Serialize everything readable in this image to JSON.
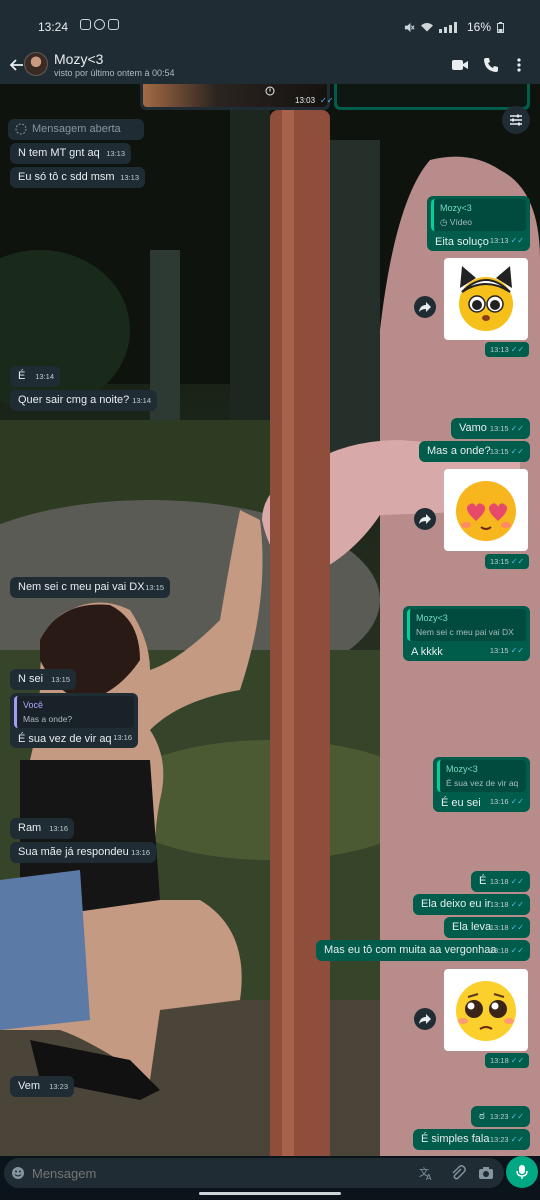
{
  "status_bar": {
    "time": "13:24",
    "battery": "16%"
  },
  "header": {
    "contact_name": "Mozy<3",
    "last_seen": "visto por último ontem à 00:54"
  },
  "top_media": {
    "time": "13:03"
  },
  "messages": {
    "m1": {
      "text": "Mensagem aberta"
    },
    "m2": {
      "text": "N tem MT gnt aq",
      "time": "13:13"
    },
    "m3": {
      "text": "Eu só tô c sdd msm",
      "time": "13:13"
    },
    "m4": {
      "quote_name": "Mozy<3",
      "quote_text": "Vídeo",
      "text": "Eita soluço",
      "time": "13:13"
    },
    "m5": {
      "time": "13:13"
    },
    "m6": {
      "text": "É",
      "time": "13:14"
    },
    "m7": {
      "text": "Quer sair cmg a noite?",
      "time": "13:14"
    },
    "m8": {
      "text": "Vamo",
      "time": "13:15"
    },
    "m9": {
      "text": "Mas a onde?",
      "time": "13:15"
    },
    "m10": {
      "time": "13:15"
    },
    "m11": {
      "text": "Nem sei c meu pai vai DX",
      "time": "13:15"
    },
    "m12": {
      "quote_name": "Mozy<3",
      "quote_text": "Nem sei c meu pai vai DX",
      "text": "A kkkk",
      "time": "13:15"
    },
    "m13": {
      "text": "N sei",
      "time": "13:15"
    },
    "m14": {
      "quote_name": "Você",
      "quote_text": "Mas a onde?",
      "text": "É sua vez de vir aq",
      "time": "13:16"
    },
    "m15": {
      "quote_name": "Mozy<3",
      "quote_text": "É sua vez de vir aq",
      "text": "É eu sei",
      "time": "13:16"
    },
    "m16": {
      "text": "Ram",
      "time": "13:16"
    },
    "m17": {
      "text": "Sua mãe já respondeu",
      "time": "13:16"
    },
    "m18": {
      "text": "É",
      "time": "13:18"
    },
    "m19": {
      "text": "Ela deixo eu ir",
      "time": "13:18"
    },
    "m20": {
      "text": "Ela leva",
      "time": "13:18"
    },
    "m21": {
      "text": "Mas eu tô com muita aa vergonhaa",
      "time": "13:18"
    },
    "m22": {
      "time": "13:18"
    },
    "m23": {
      "text": "Vem",
      "time": "13:23"
    },
    "m24": {
      "text": "ಠ",
      "time": "13:23"
    },
    "m25": {
      "text": "É simples fala",
      "time": "13:23"
    }
  },
  "input": {
    "placeholder": "Mensagem"
  },
  "colors": {
    "incoming": "#1f2c34",
    "outgoing": "#005c4b",
    "accent": "#00a884",
    "read_ticks": "#53bdeb"
  }
}
